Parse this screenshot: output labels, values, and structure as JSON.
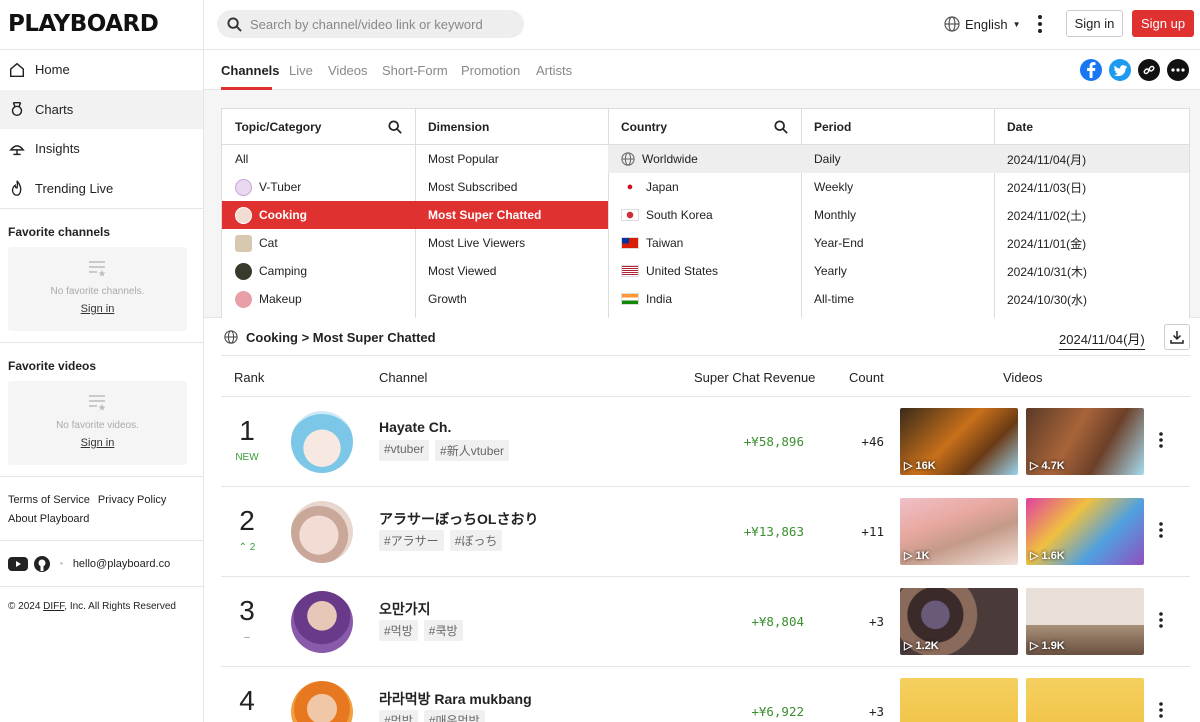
{
  "brand": {
    "logo": "PLAYBOARD",
    "accent": "#e03131",
    "positive": "#3a9b3a"
  },
  "header": {
    "search_placeholder": "Search by channel/video link or keyword",
    "language": "English",
    "signin": "Sign in",
    "signup": "Sign up"
  },
  "sidebar": {
    "nav": [
      {
        "label": "Home",
        "icon": "home-icon"
      },
      {
        "label": "Charts",
        "icon": "trophy-icon"
      },
      {
        "label": "Insights",
        "icon": "lamp-icon"
      },
      {
        "label": "Trending Live",
        "icon": "flame-icon"
      }
    ],
    "fav_channels": {
      "title": "Favorite channels",
      "empty": "No favorite channels.",
      "link": "Sign in"
    },
    "fav_videos": {
      "title": "Favorite videos",
      "empty": "No favorite videos.",
      "link": "Sign in"
    },
    "footer": {
      "terms": "Terms of Service",
      "privacy": "Privacy Policy",
      "about": "About Playboard",
      "email": "hello@playboard.co",
      "copy_prefix": "© 2024 ",
      "copy_link": "DIFF",
      "copy_suffix": ", Inc. All Rights Reserved"
    }
  },
  "tabs": [
    "Channels",
    "Live",
    "Videos",
    "Short-Form",
    "Promotion",
    "Artists"
  ],
  "filters": {
    "topic": {
      "title": "Topic/Category",
      "items": [
        "All",
        "V-Tuber",
        "Cooking",
        "Cat",
        "Camping",
        "Makeup"
      ]
    },
    "dimension": {
      "title": "Dimension",
      "items": [
        "Most Popular",
        "Most Subscribed",
        "Most Super Chatted",
        "Most Live Viewers",
        "Most Viewed",
        "Growth"
      ]
    },
    "country": {
      "title": "Country",
      "items": [
        "Worldwide",
        "Japan",
        "South Korea",
        "Taiwan",
        "United States",
        "India"
      ]
    },
    "period": {
      "title": "Period",
      "items": [
        "Daily",
        "Weekly",
        "Monthly",
        "Year-End",
        "Yearly",
        "All-time"
      ]
    },
    "date": {
      "title": "Date",
      "items": [
        "2024/11/04(月)",
        "2024/11/03(日)",
        "2024/11/02(土)",
        "2024/11/01(金)",
        "2024/10/31(木)",
        "2024/10/30(水)"
      ]
    }
  },
  "results": {
    "crumb": "Cooking > Most Super Chatted",
    "date": "2024/11/04(月)",
    "headers": {
      "rank": "Rank",
      "channel": "Channel",
      "revenue": "Super Chat Revenue",
      "count": "Count",
      "videos": "Videos"
    }
  },
  "rows": [
    {
      "rank": "1",
      "change": "NEW",
      "name": "Hayate Ch.",
      "tags": [
        "#vtuber",
        "#新人vtuber"
      ],
      "revenue": "+¥58,896",
      "count": "+46",
      "views": [
        "16K",
        "4.7K"
      ]
    },
    {
      "rank": "2",
      "change": "2",
      "name": "アラサーぼっちOLさおり",
      "tags": [
        "#アラサー",
        "#ぼっち"
      ],
      "revenue": "+¥13,863",
      "count": "+11",
      "views": [
        "1K",
        "1.6K"
      ]
    },
    {
      "rank": "3",
      "change": "–",
      "name": "오만가지",
      "tags": [
        "#먹방",
        "#쿡방"
      ],
      "revenue": "+¥8,804",
      "count": "+3",
      "views": [
        "1.2K",
        "1.9K"
      ]
    },
    {
      "rank": "4",
      "change": "",
      "name": "라라먹방 Rara mukbang",
      "tags": [
        "#먹방",
        "#매운먹방"
      ],
      "revenue": "+¥6,922",
      "count": "+3",
      "views": [
        "",
        ""
      ]
    }
  ]
}
